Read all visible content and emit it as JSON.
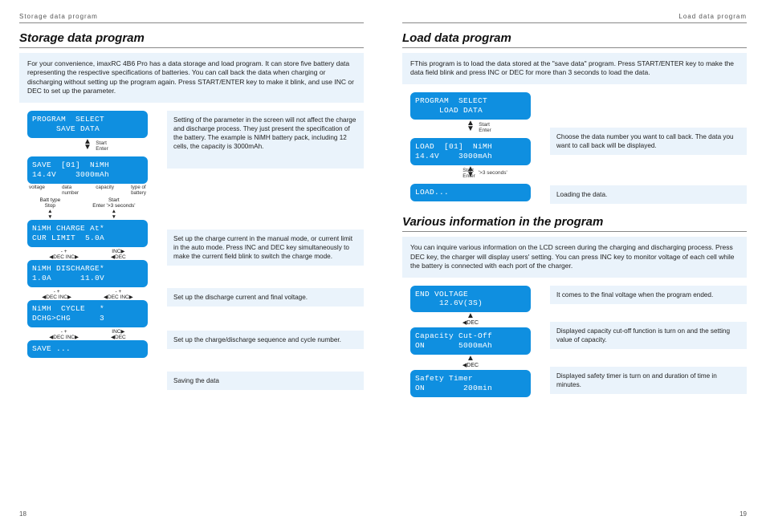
{
  "left": {
    "running_head": "Storage data program",
    "page_num": "18",
    "title": "Storage data program",
    "intro": "For your convenience, imaxRC 4B6 Pro has a data storage and load program. It can store five battery data representing the respective specifications of batteries. You can call back the data when charging or discharging without setting up the program again. Press START/ENTER key to make it blink, and use INC or DEC to set up the parameter.",
    "flow": [
      {
        "lcd": "PROGRAM  SELECT\n     SAVE DATA",
        "note": "Setting of the parameter in the screen will not affect the charge and discharge process. They just present the specification of the battery. The example is NiMH battery pack, including 12 cells, the capacity is 3000mAh."
      },
      {
        "lcd": "SAVE  [01]  NiMH\n14.4V    3000mAh",
        "note": ""
      },
      {
        "lcd": "NiMH CHARGE At*\nCUR LIMIT  5.0A",
        "note": "Set up the charge current in the manual mode, or current limit in the auto mode. Press INC and DEC key simultaneously to make the current field blink to switch the charge mode."
      },
      {
        "lcd": "NiMH DISCHARGE*\n1.0A      11.0V",
        "note": "Set up the discharge current and final voltage."
      },
      {
        "lcd": "NiMH  CYCLE   *\nDCHG>CHG      3",
        "note": "Set up the charge/discharge sequence and cycle number."
      },
      {
        "lcd": "SAVE ...",
        "note": "Saving the data"
      }
    ],
    "between": {
      "start_enter": "Start\nEnter",
      "gt3s": "'>3 seconds'",
      "batt_type_stop": "Batt type\nStop",
      "labels_row": [
        "voltage",
        "data\nnumber",
        "capacity",
        "type of\nbattery"
      ],
      "dec_inc_pair": "◀DEC  INC▶",
      "plusminus": "-    +",
      "inc_dec_col": "INC▶\n◀DEC"
    }
  },
  "right": {
    "running_head": "Load data program",
    "page_num": "19",
    "title1": "Load data program",
    "intro1": "FThis program is to load the data stored at the \"save data\" program. Press START/ENTER key to make the data field blink and press INC or DEC for more than 3 seconds to load the data.",
    "load_flow": [
      {
        "lcd": "PROGRAM  SELECT\n     LOAD DATA",
        "note": ""
      },
      {
        "lcd": "LOAD  [01]  NiMH\n14.4V    3000mAh",
        "note": "Choose the data number you want to call back. The data you want to call back will be displayed."
      },
      {
        "lcd": "LOAD...",
        "note": "Loading the data."
      }
    ],
    "between_load": {
      "start_enter": "Start\nEnter",
      "gt3s": "'>3 seconds'"
    },
    "title2": "Various information in the program",
    "intro2": "You can inquire various information on the LCD screen during the charging and discharging process. Press DEC key, the charger will display users' setting. You can press INC key to monitor voltage of each cell while the battery is connected with each port of the charger.",
    "info_flow": [
      {
        "lcd": "END VOLTAGE\n     12.6V(3S)",
        "note": "It comes to the final voltage when the program ended."
      },
      {
        "lcd": "Capacity Cut-Off\nON       5000mAh",
        "note": "Displayed capacity cut-off function is turn on and the setting value of capacity."
      },
      {
        "lcd": "Safety Timer\nON        200min",
        "note": "Displayed safety timer is turn on and duration of time in minutes."
      }
    ],
    "between_info": {
      "dec": "◀DEC"
    }
  }
}
